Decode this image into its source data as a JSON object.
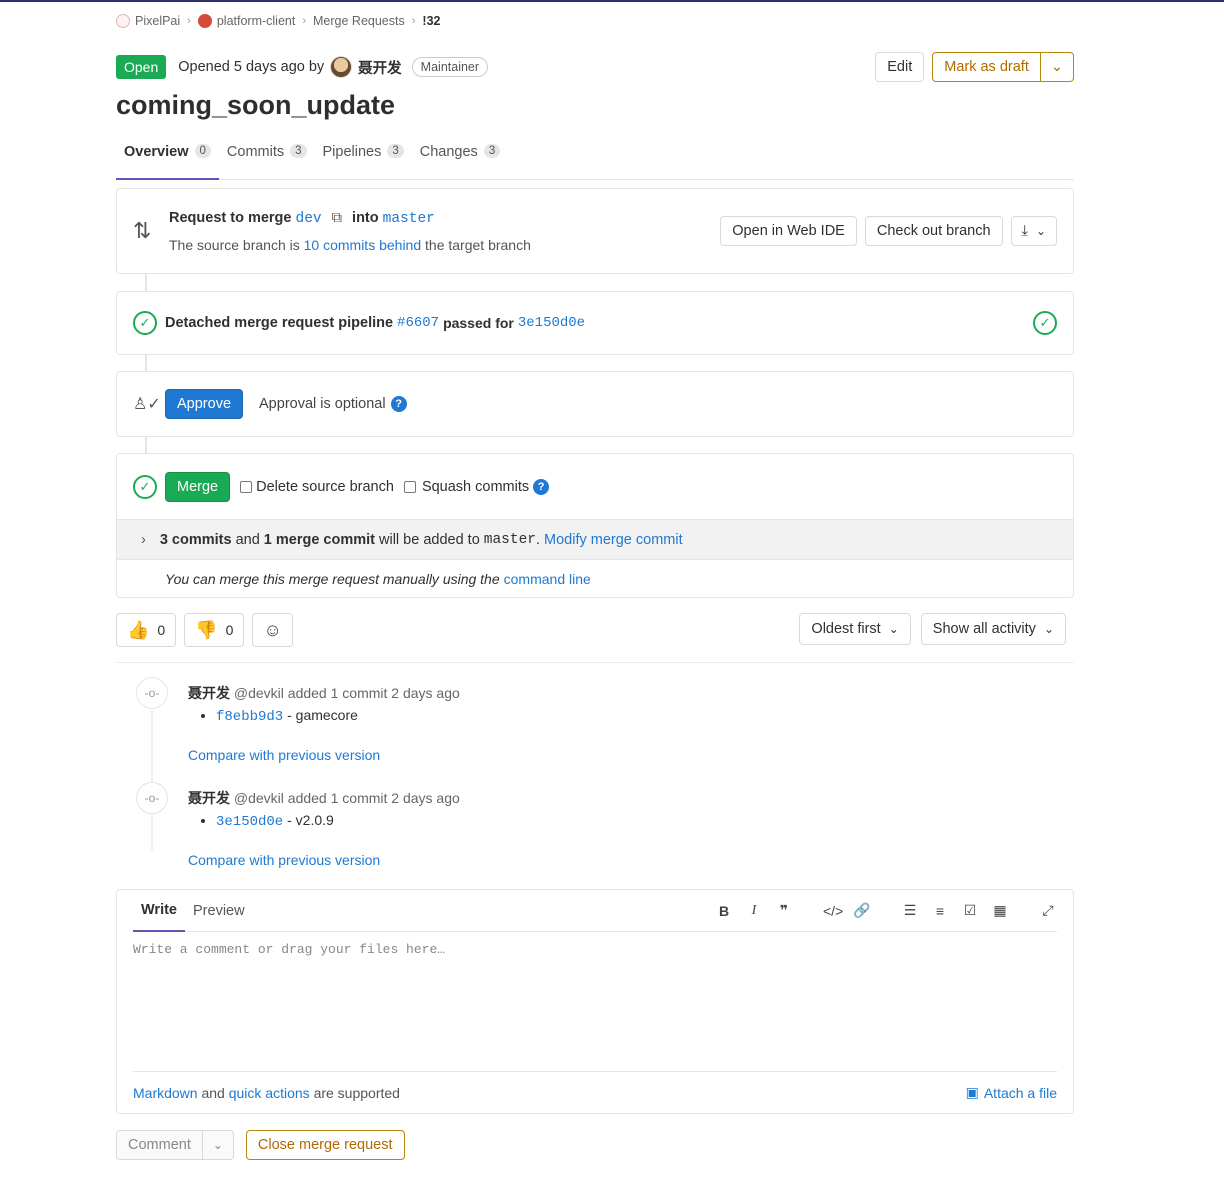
{
  "breadcrumb": {
    "group": "PixelPai",
    "project": "platform-client",
    "section": "Merge Requests",
    "current": "!32"
  },
  "header": {
    "status": "Open",
    "opened_text": "Opened 5 days ago by",
    "author": "聂开发",
    "role": "Maintainer",
    "edit_label": "Edit",
    "draft_label": "Mark as draft"
  },
  "title": "coming_soon_update",
  "tabs": [
    {
      "label": "Overview",
      "count": "0"
    },
    {
      "label": "Commits",
      "count": "3"
    },
    {
      "label": "Pipelines",
      "count": "3"
    },
    {
      "label": "Changes",
      "count": "3"
    }
  ],
  "merge_info": {
    "request_to_merge": "Request to merge",
    "source_branch": "dev",
    "into": "into",
    "target_branch": "master",
    "behind_prefix": "The source branch is",
    "behind_link": "10 commits behind",
    "behind_suffix": "the target branch",
    "web_ide_label": "Open in Web IDE",
    "checkout_label": "Check out branch"
  },
  "pipeline": {
    "text": "Detached merge request pipeline",
    "id": "#6607",
    "passed_for": "passed for",
    "sha": "3e150d0e"
  },
  "approval": {
    "approve_label": "Approve",
    "optional_text": "Approval is optional"
  },
  "merge": {
    "merge_label": "Merge",
    "delete_source": "Delete source branch",
    "squash": "Squash commits",
    "commits_count": "3 commits",
    "and": "and",
    "merge_commit": "1 merge commit",
    "will_be_added": "will be added to",
    "target": "master",
    "modify_link": "Modify merge commit",
    "manual_text": "You can merge this merge request manually using the",
    "command_line": "command line"
  },
  "reactions": {
    "thumbs_up_count": "0",
    "thumbs_down_count": "0",
    "sort_label": "Oldest first",
    "filter_label": "Show all activity"
  },
  "events": [
    {
      "author": "聂开发",
      "meta": "@devkil added 1 commit 2 days ago",
      "sha": "f8ebb9d3",
      "message": "- gamecore",
      "compare": "Compare with previous version"
    },
    {
      "author": "聂开发",
      "meta": "@devkil added 1 commit 2 days ago",
      "sha": "3e150d0e",
      "message": "- v2.0.9",
      "compare": "Compare with previous version"
    }
  ],
  "editor": {
    "write_tab": "Write",
    "preview_tab": "Preview",
    "placeholder": "Write a comment or drag your files here…",
    "markdown_link": "Markdown",
    "and": "and",
    "quick_actions_link": "quick actions",
    "supported": "are supported",
    "attach_label": "Attach a file"
  },
  "bottom": {
    "comment_label": "Comment",
    "close_label": "Close merge request"
  },
  "colors": {
    "accent": "#1f78d1",
    "success": "#1aaa55",
    "warning": "#b26a00",
    "tab_underline": "#6b4fbb"
  }
}
